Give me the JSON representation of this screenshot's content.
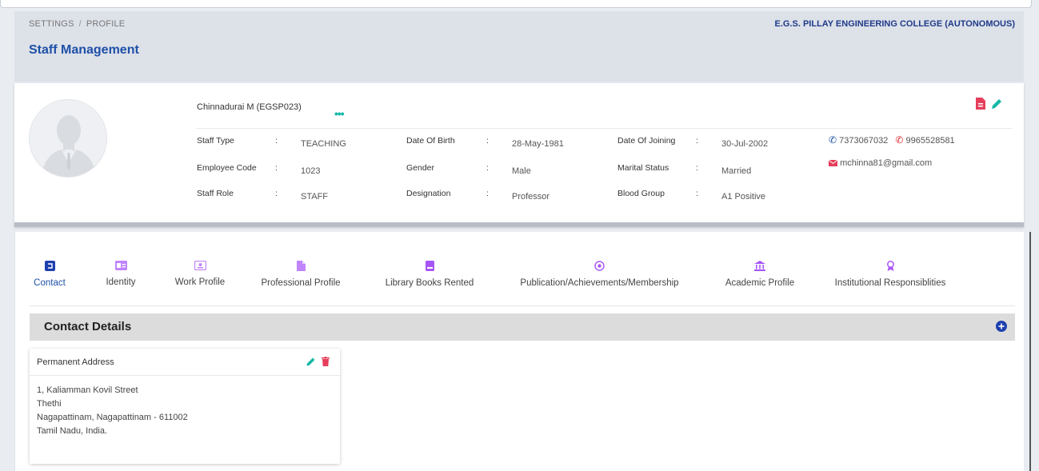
{
  "breadcrumb": {
    "parent": "SETTINGS",
    "separator": "/",
    "current": "PROFILE"
  },
  "college_name": "E.G.S. PILLAY ENGINEERING COLLEGE (AUTONOMOUS)",
  "page_title": "Staff Management",
  "profile": {
    "name": "Chinnadurai M (EGSP023)",
    "more_label": "•••",
    "fields": {
      "staff_type": {
        "label": "Staff Type",
        "value": "TEACHING"
      },
      "employee_code": {
        "label": "Employee Code",
        "value": "1023"
      },
      "staff_role": {
        "label": "Staff Role",
        "value": "STAFF"
      },
      "dob": {
        "label": "Date Of Birth",
        "value": "28-May-1981"
      },
      "gender": {
        "label": "Gender",
        "value": "Male"
      },
      "designation": {
        "label": "Designation",
        "value": "Professor"
      },
      "doj": {
        "label": "Date Of Joining",
        "value": "30-Jul-2002"
      },
      "marital_status": {
        "label": "Marital Status",
        "value": "Married"
      },
      "blood_group": {
        "label": "Blood Group",
        "value": "A1 Positive"
      }
    },
    "colon": ":",
    "phone1": "7373067032",
    "phone2": "9965528581",
    "email": "mchinna81@gmail.com"
  },
  "tabs": [
    {
      "label": "Contact",
      "icon": "address-book-icon",
      "active": true
    },
    {
      "label": "Identity",
      "icon": "id-card-icon"
    },
    {
      "label": "Work Profile",
      "icon": "id-badge-icon"
    },
    {
      "label": "Professional Profile",
      "icon": "file-icon"
    },
    {
      "label": "Library Books Rented",
      "icon": "book-icon"
    },
    {
      "label": "Publication/Achievements/Membership",
      "icon": "badge-icon"
    },
    {
      "label": "Academic Profile",
      "icon": "university-icon"
    },
    {
      "label": "Institutional Responsiblities",
      "icon": "award-icon"
    }
  ],
  "section": {
    "title": "Contact Details"
  },
  "address": {
    "title": "Permanent Address",
    "line1": "1, Kaliamman Kovil Street",
    "line2": "Thethi",
    "line3": "Nagapattinam, Nagapattinam - 611002",
    "line4": "Tamil Nadu, India."
  },
  "colors": {
    "accent": "#1e50a8",
    "teal": "#14b8a6",
    "purple": "#a855f7",
    "danger": "#e53e5a"
  }
}
